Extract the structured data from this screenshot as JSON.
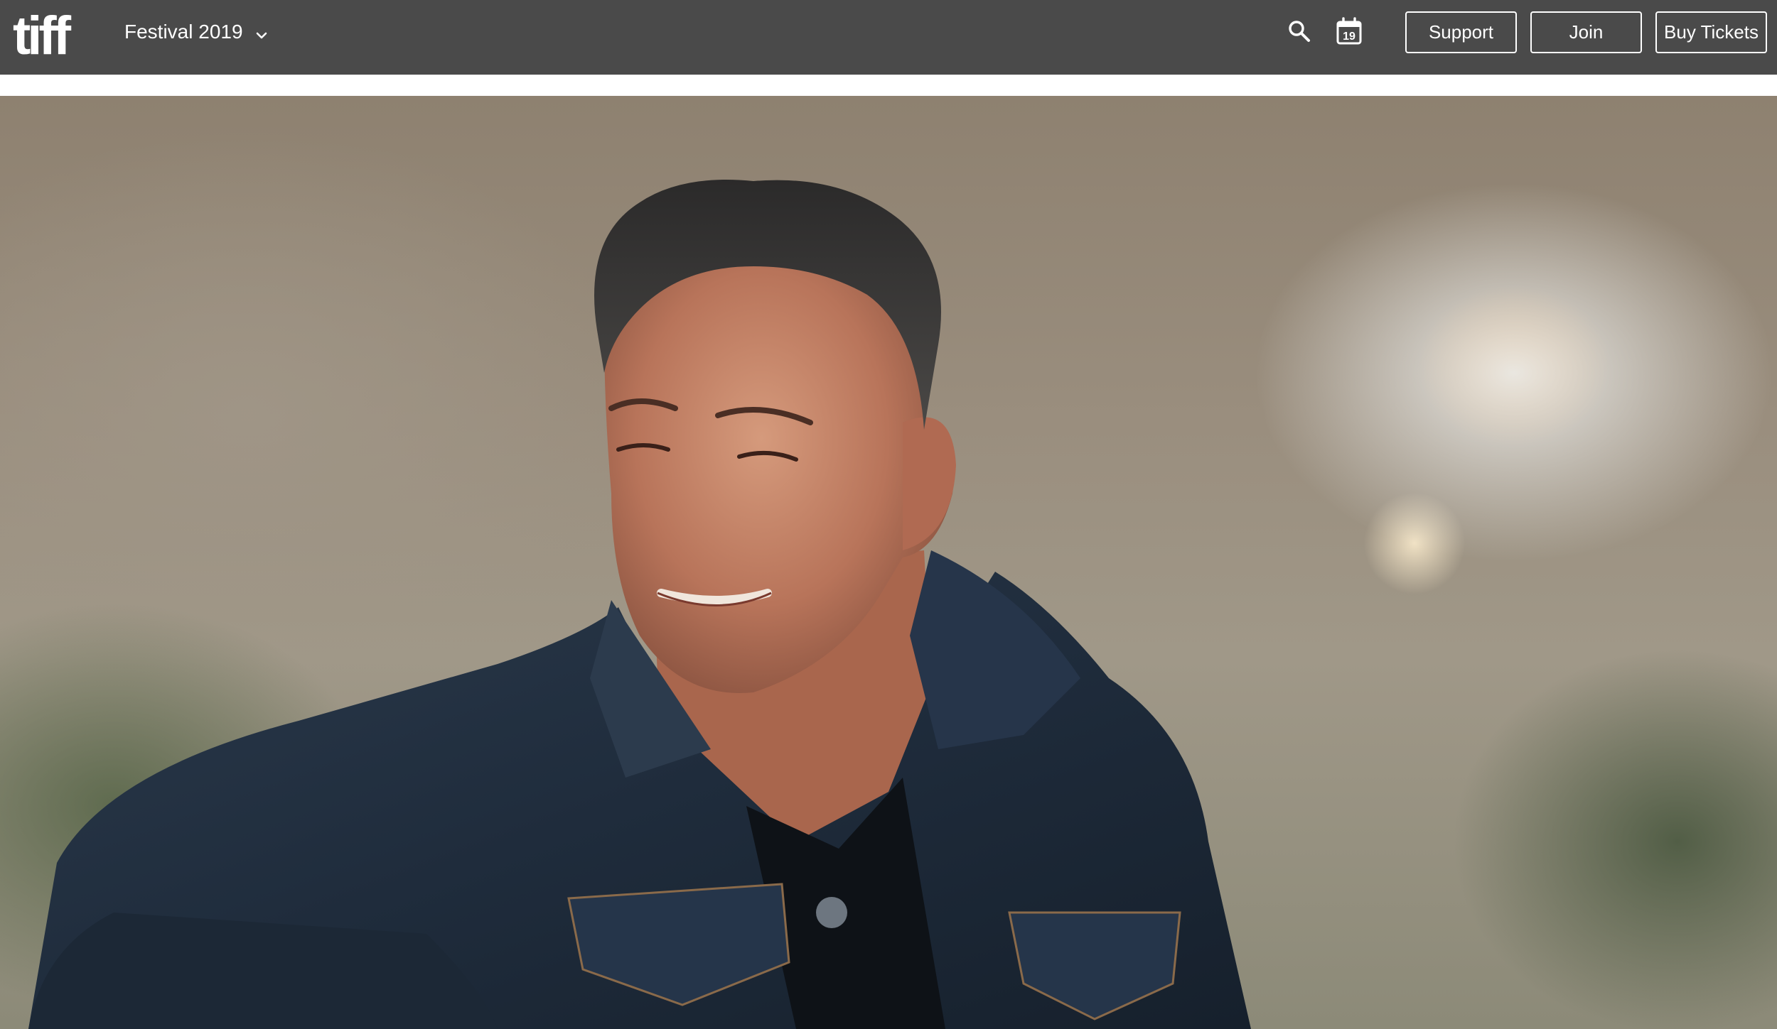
{
  "header": {
    "logo_text": "tiff",
    "festival_label": "Festival 2019",
    "calendar_day": "19",
    "buttons": {
      "support": "Support",
      "join": "Join",
      "buy_tickets": "Buy Tickets"
    }
  },
  "icons": {
    "festival_dropdown": "chevron-down-icon",
    "search": "search-icon",
    "calendar": "calendar-icon"
  },
  "colors": {
    "topbar_background": "#4a4a4a",
    "header_text": "#ffffff",
    "denim_jacket": "#1f2d3d"
  }
}
